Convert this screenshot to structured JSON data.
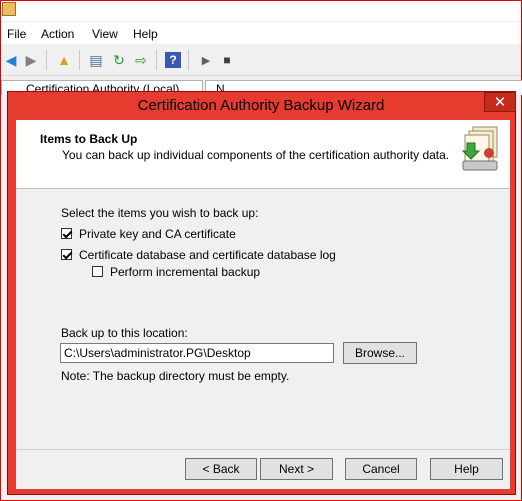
{
  "mmc": {
    "menu": [
      "File",
      "Action",
      "View",
      "Help"
    ],
    "tree_label": "Certification Authority (Local)",
    "right_header": "N"
  },
  "wizard": {
    "title": "Certification Authority Backup Wizard",
    "close_label": "✕",
    "header_title": "Items to Back Up",
    "header_subtitle": "You can back up individual components of the certification authority data.",
    "select_prompt": "Select the items you wish to back up:",
    "options": [
      {
        "label": "Private key and CA certificate",
        "checked": true
      },
      {
        "label": "Certificate database and certificate database log",
        "checked": true
      },
      {
        "label": "Perform incremental backup",
        "checked": false
      }
    ],
    "location_label": "Back up to this location:",
    "location_value": "C:\\Users\\administrator.PG\\Desktop",
    "browse_label": "Browse...",
    "note": "Note: The backup directory must be empty.",
    "buttons": {
      "back": "< Back",
      "next": "Next >",
      "cancel": "Cancel",
      "help": "Help"
    }
  },
  "colors": {
    "accent_border": "#e00000",
    "dialog_frame": "#e63b2f",
    "close_button": "#c42b1c"
  }
}
